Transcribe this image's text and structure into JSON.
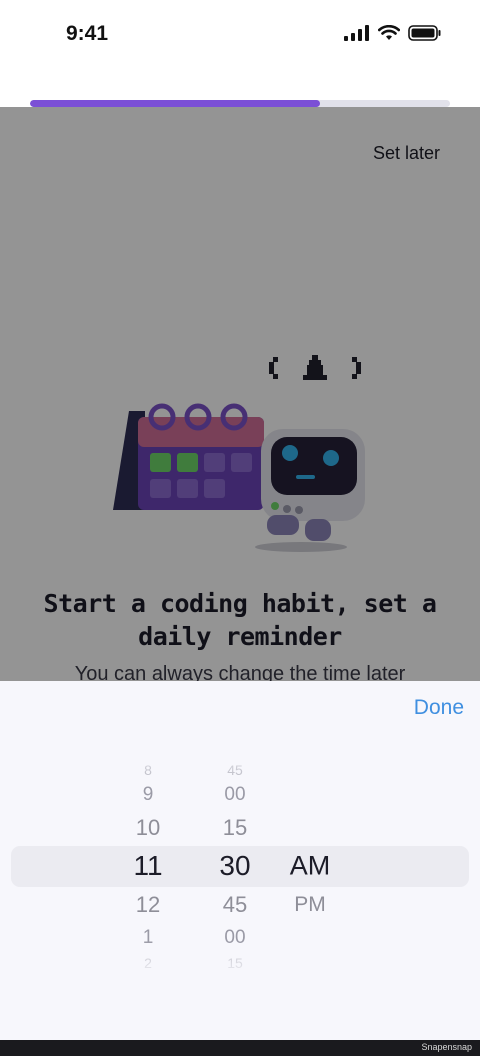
{
  "status_bar": {
    "time": "9:41",
    "icons": [
      "signal-icon",
      "wifi-icon",
      "battery-icon"
    ]
  },
  "progress": {
    "fraction": 0.69,
    "color": "#7b4fd6"
  },
  "header": {
    "set_later_label": "Set later"
  },
  "illustration": {
    "name": "robot-with-calendar-and-bell"
  },
  "main": {
    "headline_line1": "Start a coding habit, set a",
    "headline_line2": "daily reminder",
    "subtext": "You can always change the time later"
  },
  "picker": {
    "done_label": "Done",
    "hours": [
      "8",
      "9",
      "10",
      "11",
      "12",
      "1",
      "2"
    ],
    "minutes": [
      "45",
      "00",
      "15",
      "30",
      "45",
      "00",
      "15"
    ],
    "periods": [
      "AM",
      "PM"
    ],
    "selected": {
      "hour": "11",
      "minute": "30",
      "period": "AM"
    }
  },
  "footer": {
    "text": "Snapensnap"
  },
  "colors": {
    "accent": "#7b4fd6",
    "done": "#3f8fe0",
    "overlay": "rgba(0,0,0,0.42)"
  }
}
